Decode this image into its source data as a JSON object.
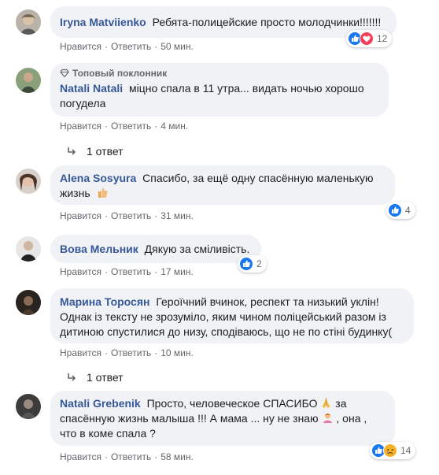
{
  "comments": [
    {
      "author": "Iryna Matviienko",
      "text": "Ребята-полицейские просто молодчинки!!!!!!!",
      "like_label": "Нравится",
      "reply_label": "Ответить",
      "time": "50 мин.",
      "reactions": [
        "like",
        "love"
      ],
      "reaction_count": "12"
    },
    {
      "badge": "Топовый поклонник",
      "author": "Natali Natali",
      "text": "міцно спала в 11 утра... видать ночью хорошо погудела",
      "like_label": "Нравится",
      "reply_label": "Ответить",
      "time": "4 мин.",
      "replies_label": "1 ответ"
    },
    {
      "author": "Alena Sosyura",
      "text": "Спасибо, за ещё одну спасённую маленькую жизнь",
      "like_label": "Нравится",
      "reply_label": "Ответить",
      "time": "31 мин.",
      "reactions": [
        "like"
      ],
      "reaction_count": "4"
    },
    {
      "author": "Вова Мельник",
      "text": "Дякую за сміливість.",
      "like_label": "Нравится",
      "reply_label": "Ответить",
      "time": "17 мин.",
      "reactions": [
        "like"
      ],
      "reaction_count": "2"
    },
    {
      "author": "Марина Торосян",
      "text": "Героїчний вчинок, респект та низький уклін! Однак із тексту не зрозуміло, яким чином поліцейський разом із дитиною спустилися до низу, сподіваюсь, що не по стіні будинку(",
      "like_label": "Нравится",
      "reply_label": "Ответить",
      "time": "10 мин.",
      "replies_label": "1 ответ"
    },
    {
      "author": "Natali Grebenik",
      "text_before": "Просто, человеческое СПАСИБО",
      "text_middle": "за спасённую жизнь малыша !!! А мама ... ну не знаю",
      "text_after": ", она , что в коме спала ?",
      "like_label": "Нравится",
      "reply_label": "Ответить",
      "time": "58 мин.",
      "reactions": [
        "like",
        "sad"
      ],
      "reaction_count": "14"
    }
  ],
  "colors": {
    "author": "#365899",
    "bubble": "#f0f2f5",
    "meta": "#65676b",
    "like": "#1877f2",
    "love": "#f33e58",
    "sad": "#f7b125"
  }
}
